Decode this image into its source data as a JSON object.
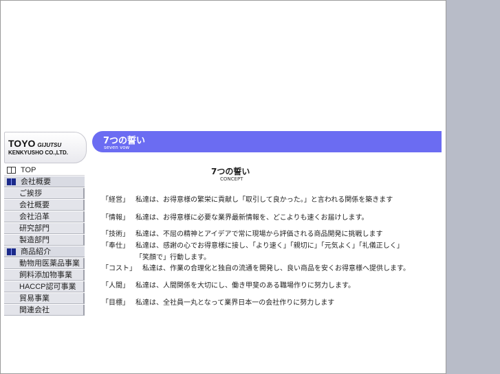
{
  "logo": {
    "big": "TOYO",
    "small": "GIJUTSU",
    "line2": "KENKYUSHO CO.,LTD."
  },
  "banner": {
    "title": "7つの誓い",
    "subtitle": "seven vow"
  },
  "sidebar": {
    "items": [
      {
        "label": "TOP",
        "icon": "book-open-icon"
      },
      {
        "label": "会社概要",
        "icon": "book-filled-icon"
      },
      {
        "label": "ご挨拶"
      },
      {
        "label": "会社概要"
      },
      {
        "label": "会社沿革"
      },
      {
        "label": "研究部門"
      },
      {
        "label": "製造部門"
      },
      {
        "label": "商品紹介",
        "icon": "book-filled-icon"
      },
      {
        "label": "動物用医薬品事業"
      },
      {
        "label": "飼料添加物事業"
      },
      {
        "label": "HACCP認可事業"
      },
      {
        "label": "貿易事業"
      },
      {
        "label": "関連会社"
      }
    ]
  },
  "content": {
    "title": "7つの誓い",
    "subtitle": "CONCEPT",
    "vows": [
      {
        "key": "「経営」",
        "text": "私達は、お得意様の繁栄に貢献し「取引して良かった。」と言われる関係を築きます"
      },
      {
        "key": "「情報」",
        "text": "私達は、お得意様に必要な業界最新情報を、どこよりも速くお届けします。"
      },
      {
        "key": "「技術」",
        "text": "私達は、不屈の精神とアイデアで常に現場から評価される商品開発に挑戦します"
      },
      {
        "key": "「奉仕」",
        "text": "私達は、感謝の心でお得意様に接し、「より速く」「親切に」「元気よく」「礼儀正しく」",
        "text2": "「笑顔で」行動します。"
      },
      {
        "key": "「コスト」",
        "text": "私達は、作業の合理化と独自の流通を開発し、良い商品を安くお得意様へ提供します。"
      },
      {
        "key": "「人間」",
        "text": "私達は、人間関係を大切にし、働き甲斐のある職場作りに努力します。"
      },
      {
        "key": "「目標」",
        "text": "私達は、全社員一丸となって業界日本一の会社作りに努力します"
      }
    ]
  }
}
